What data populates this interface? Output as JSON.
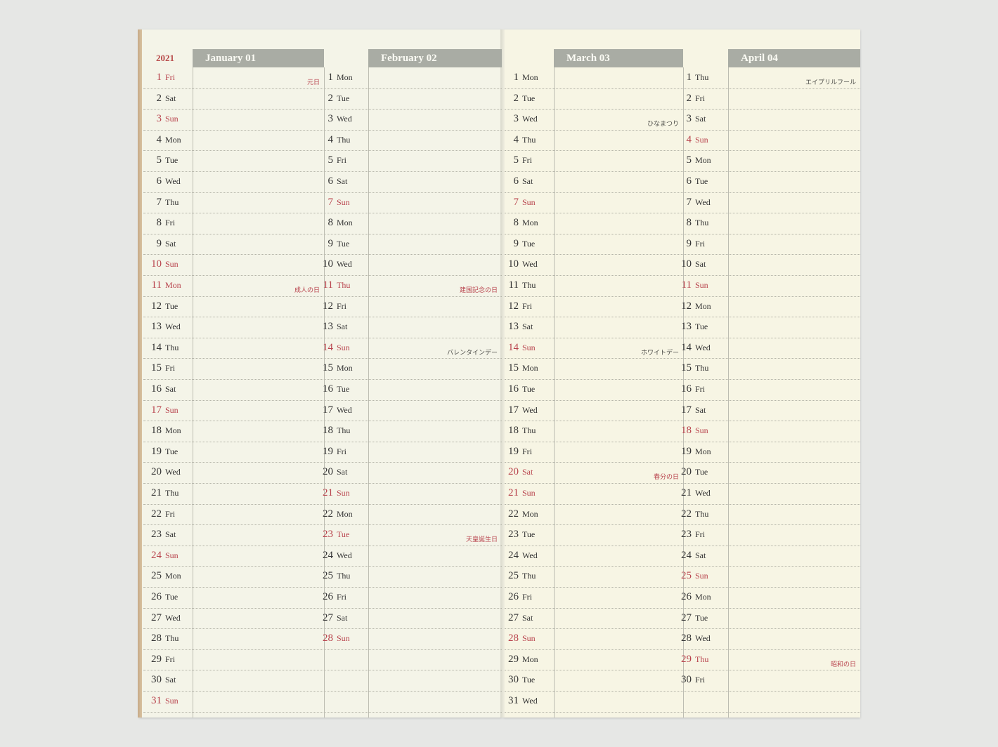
{
  "year": "2021",
  "colors": {
    "background": "#e6e7e5",
    "paper_left": "#f4f4e8",
    "paper_right": "#f7f5e4",
    "header_band": "#a9aca4",
    "sunday_red": "#b8424c",
    "spine": "#c7ab88"
  },
  "months": [
    {
      "title": "January 01",
      "days": [
        {
          "n": "1",
          "w": "Fri",
          "red": true,
          "holiday": "元日"
        },
        {
          "n": "2",
          "w": "Sat"
        },
        {
          "n": "3",
          "w": "Sun",
          "red": true
        },
        {
          "n": "4",
          "w": "Mon"
        },
        {
          "n": "5",
          "w": "Tue"
        },
        {
          "n": "6",
          "w": "Wed"
        },
        {
          "n": "7",
          "w": "Thu"
        },
        {
          "n": "8",
          "w": "Fri"
        },
        {
          "n": "9",
          "w": "Sat"
        },
        {
          "n": "10",
          "w": "Sun",
          "red": true
        },
        {
          "n": "11",
          "w": "Mon",
          "red": true,
          "holiday": "成人の日"
        },
        {
          "n": "12",
          "w": "Tue"
        },
        {
          "n": "13",
          "w": "Wed"
        },
        {
          "n": "14",
          "w": "Thu"
        },
        {
          "n": "15",
          "w": "Fri"
        },
        {
          "n": "16",
          "w": "Sat"
        },
        {
          "n": "17",
          "w": "Sun",
          "red": true
        },
        {
          "n": "18",
          "w": "Mon"
        },
        {
          "n": "19",
          "w": "Tue"
        },
        {
          "n": "20",
          "w": "Wed"
        },
        {
          "n": "21",
          "w": "Thu"
        },
        {
          "n": "22",
          "w": "Fri"
        },
        {
          "n": "23",
          "w": "Sat"
        },
        {
          "n": "24",
          "w": "Sun",
          "red": true
        },
        {
          "n": "25",
          "w": "Mon"
        },
        {
          "n": "26",
          "w": "Tue"
        },
        {
          "n": "27",
          "w": "Wed"
        },
        {
          "n": "28",
          "w": "Thu"
        },
        {
          "n": "29",
          "w": "Fri"
        },
        {
          "n": "30",
          "w": "Sat"
        },
        {
          "n": "31",
          "w": "Sun",
          "red": true
        }
      ]
    },
    {
      "title": "February 02",
      "days": [
        {
          "n": "1",
          "w": "Mon"
        },
        {
          "n": "2",
          "w": "Tue"
        },
        {
          "n": "3",
          "w": "Wed"
        },
        {
          "n": "4",
          "w": "Thu"
        },
        {
          "n": "5",
          "w": "Fri"
        },
        {
          "n": "6",
          "w": "Sat"
        },
        {
          "n": "7",
          "w": "Sun",
          "red": true
        },
        {
          "n": "8",
          "w": "Mon"
        },
        {
          "n": "9",
          "w": "Tue"
        },
        {
          "n": "10",
          "w": "Wed"
        },
        {
          "n": "11",
          "w": "Thu",
          "red": true,
          "holiday": "建国記念の日"
        },
        {
          "n": "12",
          "w": "Fri"
        },
        {
          "n": "13",
          "w": "Sat"
        },
        {
          "n": "14",
          "w": "Sun",
          "red": true,
          "holiday": "バレンタインデー",
          "holiday_dark": true
        },
        {
          "n": "15",
          "w": "Mon"
        },
        {
          "n": "16",
          "w": "Tue"
        },
        {
          "n": "17",
          "w": "Wed"
        },
        {
          "n": "18",
          "w": "Thu"
        },
        {
          "n": "19",
          "w": "Fri"
        },
        {
          "n": "20",
          "w": "Sat"
        },
        {
          "n": "21",
          "w": "Sun",
          "red": true
        },
        {
          "n": "22",
          "w": "Mon"
        },
        {
          "n": "23",
          "w": "Tue",
          "red": true,
          "holiday": "天皇誕生日"
        },
        {
          "n": "24",
          "w": "Wed"
        },
        {
          "n": "25",
          "w": "Thu"
        },
        {
          "n": "26",
          "w": "Fri"
        },
        {
          "n": "27",
          "w": "Sat"
        },
        {
          "n": "28",
          "w": "Sun",
          "red": true
        }
      ]
    },
    {
      "title": "March 03",
      "days": [
        {
          "n": "1",
          "w": "Mon"
        },
        {
          "n": "2",
          "w": "Tue"
        },
        {
          "n": "3",
          "w": "Wed",
          "holiday": "ひなまつり",
          "holiday_dark": true
        },
        {
          "n": "4",
          "w": "Thu"
        },
        {
          "n": "5",
          "w": "Fri"
        },
        {
          "n": "6",
          "w": "Sat"
        },
        {
          "n": "7",
          "w": "Sun",
          "red": true
        },
        {
          "n": "8",
          "w": "Mon"
        },
        {
          "n": "9",
          "w": "Tue"
        },
        {
          "n": "10",
          "w": "Wed"
        },
        {
          "n": "11",
          "w": "Thu"
        },
        {
          "n": "12",
          "w": "Fri"
        },
        {
          "n": "13",
          "w": "Sat"
        },
        {
          "n": "14",
          "w": "Sun",
          "red": true,
          "holiday": "ホワイトデー",
          "holiday_dark": true
        },
        {
          "n": "15",
          "w": "Mon"
        },
        {
          "n": "16",
          "w": "Tue"
        },
        {
          "n": "17",
          "w": "Wed"
        },
        {
          "n": "18",
          "w": "Thu"
        },
        {
          "n": "19",
          "w": "Fri"
        },
        {
          "n": "20",
          "w": "Sat",
          "red": true,
          "holiday": "春分の日"
        },
        {
          "n": "21",
          "w": "Sun",
          "red": true
        },
        {
          "n": "22",
          "w": "Mon"
        },
        {
          "n": "23",
          "w": "Tue"
        },
        {
          "n": "24",
          "w": "Wed"
        },
        {
          "n": "25",
          "w": "Thu"
        },
        {
          "n": "26",
          "w": "Fri"
        },
        {
          "n": "27",
          "w": "Sat"
        },
        {
          "n": "28",
          "w": "Sun",
          "red": true
        },
        {
          "n": "29",
          "w": "Mon"
        },
        {
          "n": "30",
          "w": "Tue"
        },
        {
          "n": "31",
          "w": "Wed"
        }
      ]
    },
    {
      "title": "April 04",
      "days": [
        {
          "n": "1",
          "w": "Thu",
          "holiday": "エイプリルフール",
          "holiday_dark": true
        },
        {
          "n": "2",
          "w": "Fri"
        },
        {
          "n": "3",
          "w": "Sat"
        },
        {
          "n": "4",
          "w": "Sun",
          "red": true
        },
        {
          "n": "5",
          "w": "Mon"
        },
        {
          "n": "6",
          "w": "Tue"
        },
        {
          "n": "7",
          "w": "Wed"
        },
        {
          "n": "8",
          "w": "Thu"
        },
        {
          "n": "9",
          "w": "Fri"
        },
        {
          "n": "10",
          "w": "Sat"
        },
        {
          "n": "11",
          "w": "Sun",
          "red": true
        },
        {
          "n": "12",
          "w": "Mon"
        },
        {
          "n": "13",
          "w": "Tue"
        },
        {
          "n": "14",
          "w": "Wed"
        },
        {
          "n": "15",
          "w": "Thu"
        },
        {
          "n": "16",
          "w": "Fri"
        },
        {
          "n": "17",
          "w": "Sat"
        },
        {
          "n": "18",
          "w": "Sun",
          "red": true
        },
        {
          "n": "19",
          "w": "Mon"
        },
        {
          "n": "20",
          "w": "Tue"
        },
        {
          "n": "21",
          "w": "Wed"
        },
        {
          "n": "22",
          "w": "Thu"
        },
        {
          "n": "23",
          "w": "Fri"
        },
        {
          "n": "24",
          "w": "Sat"
        },
        {
          "n": "25",
          "w": "Sun",
          "red": true
        },
        {
          "n": "26",
          "w": "Mon"
        },
        {
          "n": "27",
          "w": "Tue"
        },
        {
          "n": "28",
          "w": "Wed"
        },
        {
          "n": "29",
          "w": "Thu",
          "red": true,
          "holiday": "昭和の日"
        },
        {
          "n": "30",
          "w": "Fri"
        }
      ]
    }
  ]
}
